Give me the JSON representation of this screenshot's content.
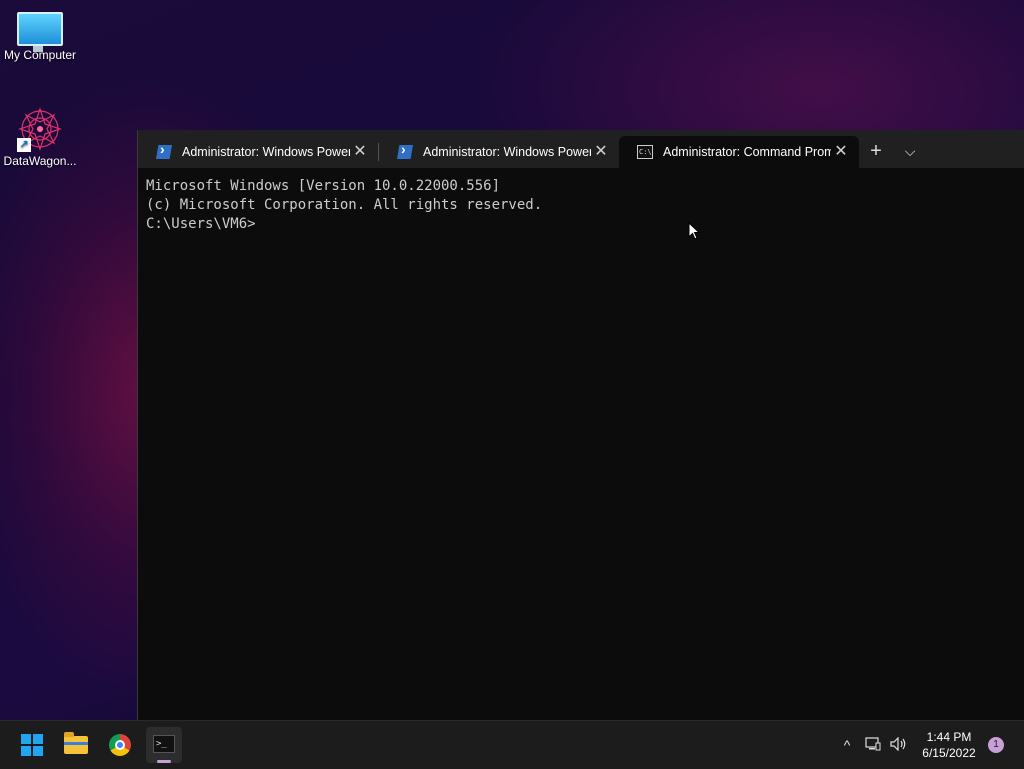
{
  "desktop": {
    "icons": [
      {
        "label": "My Computer",
        "icon": "monitor-icon"
      },
      {
        "label": "DataWagon...",
        "icon": "datawagon-icon"
      }
    ]
  },
  "terminal": {
    "tabs": [
      {
        "title": "Administrator: Windows PowerShell",
        "icon": "powershell-icon",
        "active": false
      },
      {
        "title": "Administrator: Windows PowerShell",
        "icon": "powershell-icon",
        "active": false
      },
      {
        "title": "Administrator: Command Prompt",
        "icon": "cmd-icon",
        "active": true
      }
    ],
    "new_tab_label": "+",
    "dropdown_label": "⌵",
    "close_glyph": "✕",
    "console_lines": [
      "Microsoft Windows [Version 10.0.22000.556]",
      "(c) Microsoft Corporation. All rights reserved.",
      "",
      "C:\\Users\\VM6>"
    ]
  },
  "taskbar": {
    "apps": [
      {
        "name": "Start",
        "icon": "windows-icon"
      },
      {
        "name": "File Explorer",
        "icon": "folder-icon"
      },
      {
        "name": "Google Chrome",
        "icon": "chrome-icon"
      },
      {
        "name": "Windows Terminal",
        "icon": "terminal-icon",
        "active": true
      }
    ],
    "tray": {
      "chevron": "^",
      "time": "1:44 PM",
      "date": "6/15/2022",
      "notification_count": "1"
    }
  },
  "colors": {
    "accent": "#c7a0d8",
    "console_bg": "#0c0c0c",
    "tabbar_bg": "#202020",
    "taskbar_bg": "#1c1c1c"
  }
}
